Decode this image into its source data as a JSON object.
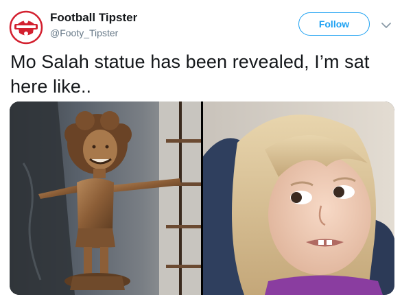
{
  "tweet": {
    "author": {
      "display_name": "Football Tipster",
      "handle": "@Footy_Tipster",
      "avatar_icon": "football-tipster-logo-icon"
    },
    "follow_label": "Follow",
    "menu_icon": "chevron-down-icon",
    "text": "Mo Salah statue has been revealed, I’m sat here like..",
    "media": [
      {
        "description_icon": "salah-statue-photo"
      },
      {
        "description_icon": "side-eye-girl-photo"
      }
    ]
  },
  "colors": {
    "accent": "#1da1f2",
    "text": "#14171a",
    "muted": "#657786",
    "brand_red": "#d3202f"
  }
}
